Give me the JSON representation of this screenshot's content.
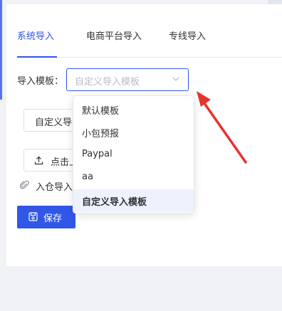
{
  "tabs": [
    {
      "label": "系统导入",
      "active": true
    },
    {
      "label": "电商平台导入",
      "active": false
    },
    {
      "label": "专线导入",
      "active": false
    }
  ],
  "form": {
    "template_label": "导入模板：",
    "template_select": {
      "placeholder": "自定义导入模板",
      "icon": "chevron-down-icon"
    }
  },
  "buttons": {
    "custom_template_label": "自定义导入模板",
    "upload_label": "点击上传",
    "upload_icon": "upload-icon",
    "save_label": "保存",
    "save_icon": "save-icon"
  },
  "attachment": {
    "icon": "paperclip-icon",
    "label": "入仓导入模板"
  },
  "dropdown": {
    "options": [
      {
        "label": "默认模板",
        "selected": false
      },
      {
        "label": "小包预报",
        "selected": false
      },
      {
        "label": "Paypal",
        "selected": false
      },
      {
        "label": "aa",
        "selected": false
      },
      {
        "label": "自定义导入模板",
        "selected": true
      }
    ]
  },
  "colors": {
    "accent": "#2f54eb",
    "save_button": "#3157e8",
    "annotation_arrow": "#e8322c",
    "selected_option_bg": "#eef2fd"
  }
}
